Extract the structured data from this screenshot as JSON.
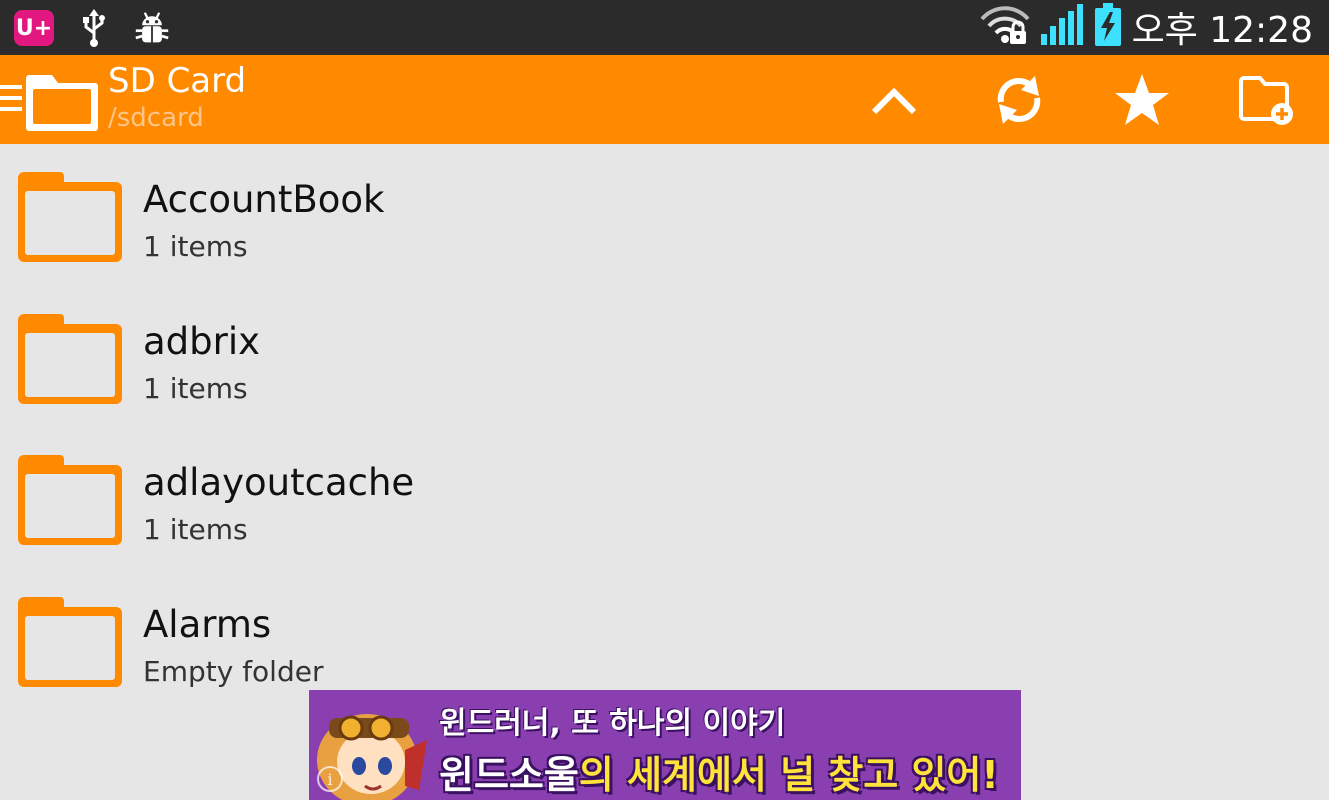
{
  "status_bar": {
    "carrier": "U+",
    "clock": "오후 12:28",
    "icons": [
      "carrier-icon",
      "usb-icon",
      "android-debug-icon",
      "wifi-lock-icon",
      "signal-icon",
      "battery-charging-icon"
    ]
  },
  "app_bar": {
    "title": "SD Card",
    "path": "/sdcard",
    "actions": [
      "up-icon",
      "refresh-icon",
      "star-icon",
      "new-folder-icon"
    ]
  },
  "files": [
    {
      "name": "AccountBook",
      "meta": "1 items"
    },
    {
      "name": "adbrix",
      "meta": "1 items"
    },
    {
      "name": "adlayoutcache",
      "meta": "1 items"
    },
    {
      "name": "Alarms",
      "meta": "Empty folder"
    }
  ],
  "ad": {
    "line1": "윈드러너, 또 하나의 이야기",
    "line2_highlight": "윈드소울",
    "line2_rest": "의 세계에서 널 찾고 있어!",
    "info": "i"
  },
  "colors": {
    "accent": "#ff8a00",
    "status_bar": "#2b2b2b",
    "background": "#e6e6e6",
    "ad_background": "#8a3fb0"
  }
}
